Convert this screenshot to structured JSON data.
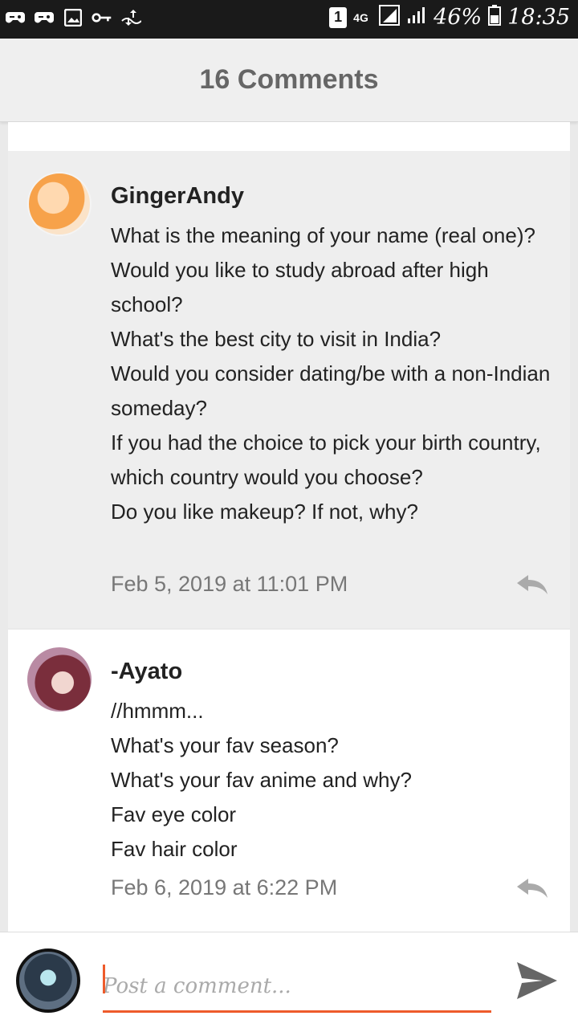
{
  "status_bar": {
    "icons": [
      "gamepad-icon",
      "gamepad-icon",
      "image-icon",
      "key-icon",
      "transfer-icon"
    ],
    "sim": "1",
    "network": "4G",
    "battery": "46%",
    "time": "18:35"
  },
  "header": {
    "title": "16 Comments"
  },
  "comments": [
    {
      "username": "GingerAndy",
      "lines": [
        "What is the meaning of your name (real one)?",
        "Would you like to study abroad after high school?",
        "What's the best city to visit in India?",
        "Would you consider dating/be with a non-Indian someday?",
        "If you had the choice to pick your birth country, which country would you choose?",
        "Do you like makeup? If not, why?"
      ],
      "timestamp": "Feb 5, 2019 at 11:01 PM"
    },
    {
      "username": "-Ayato",
      "lines": [
        "//hmmm...",
        "What's your fav season?",
        "What's your fav anime and why?",
        "Fav eye color",
        "Fav hair color"
      ],
      "timestamp": "Feb 6, 2019 at 6:22 PM"
    }
  ],
  "composer": {
    "placeholder": "Post a comment..."
  },
  "colors": {
    "accent": "#ee5b2b",
    "header_bg": "#efefef",
    "status_bg": "#1a1a1a"
  }
}
